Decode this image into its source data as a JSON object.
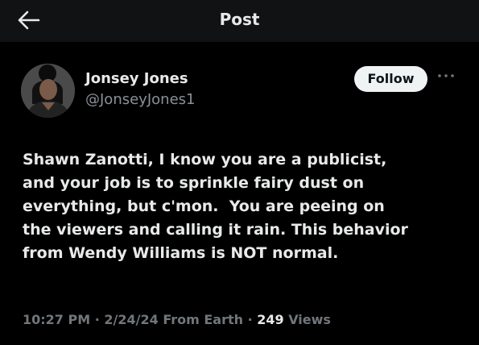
{
  "header": {
    "title": "Post",
    "back_icon": "arrow-left-icon"
  },
  "author": {
    "display_name": "Jonsey Jones",
    "handle": "@JonseyJones1",
    "avatar": "profile-photo"
  },
  "actions": {
    "follow_label": "Follow",
    "more_icon": "more-dots-icon"
  },
  "post": {
    "text_lines": [
      "Shawn Zanotti, I know you are a publicist,",
      "and your job is to sprinkle fairy dust on",
      "everything, but c'mon.  You are peeing on",
      "the viewers and calling it rain. This behavior",
      "from Wendy Williams is NOT normal."
    ]
  },
  "meta": {
    "time": "10:27 PM",
    "separator": " · ",
    "date": "2/24/24",
    "source": "From Earth",
    "views_count": "249",
    "views_label": "Views"
  },
  "colors": {
    "background": "#000000",
    "header_background": "#111214",
    "primary_text": "#e7e9ea",
    "secondary_text": "#71767b",
    "follow_button": "#eff3f4"
  }
}
